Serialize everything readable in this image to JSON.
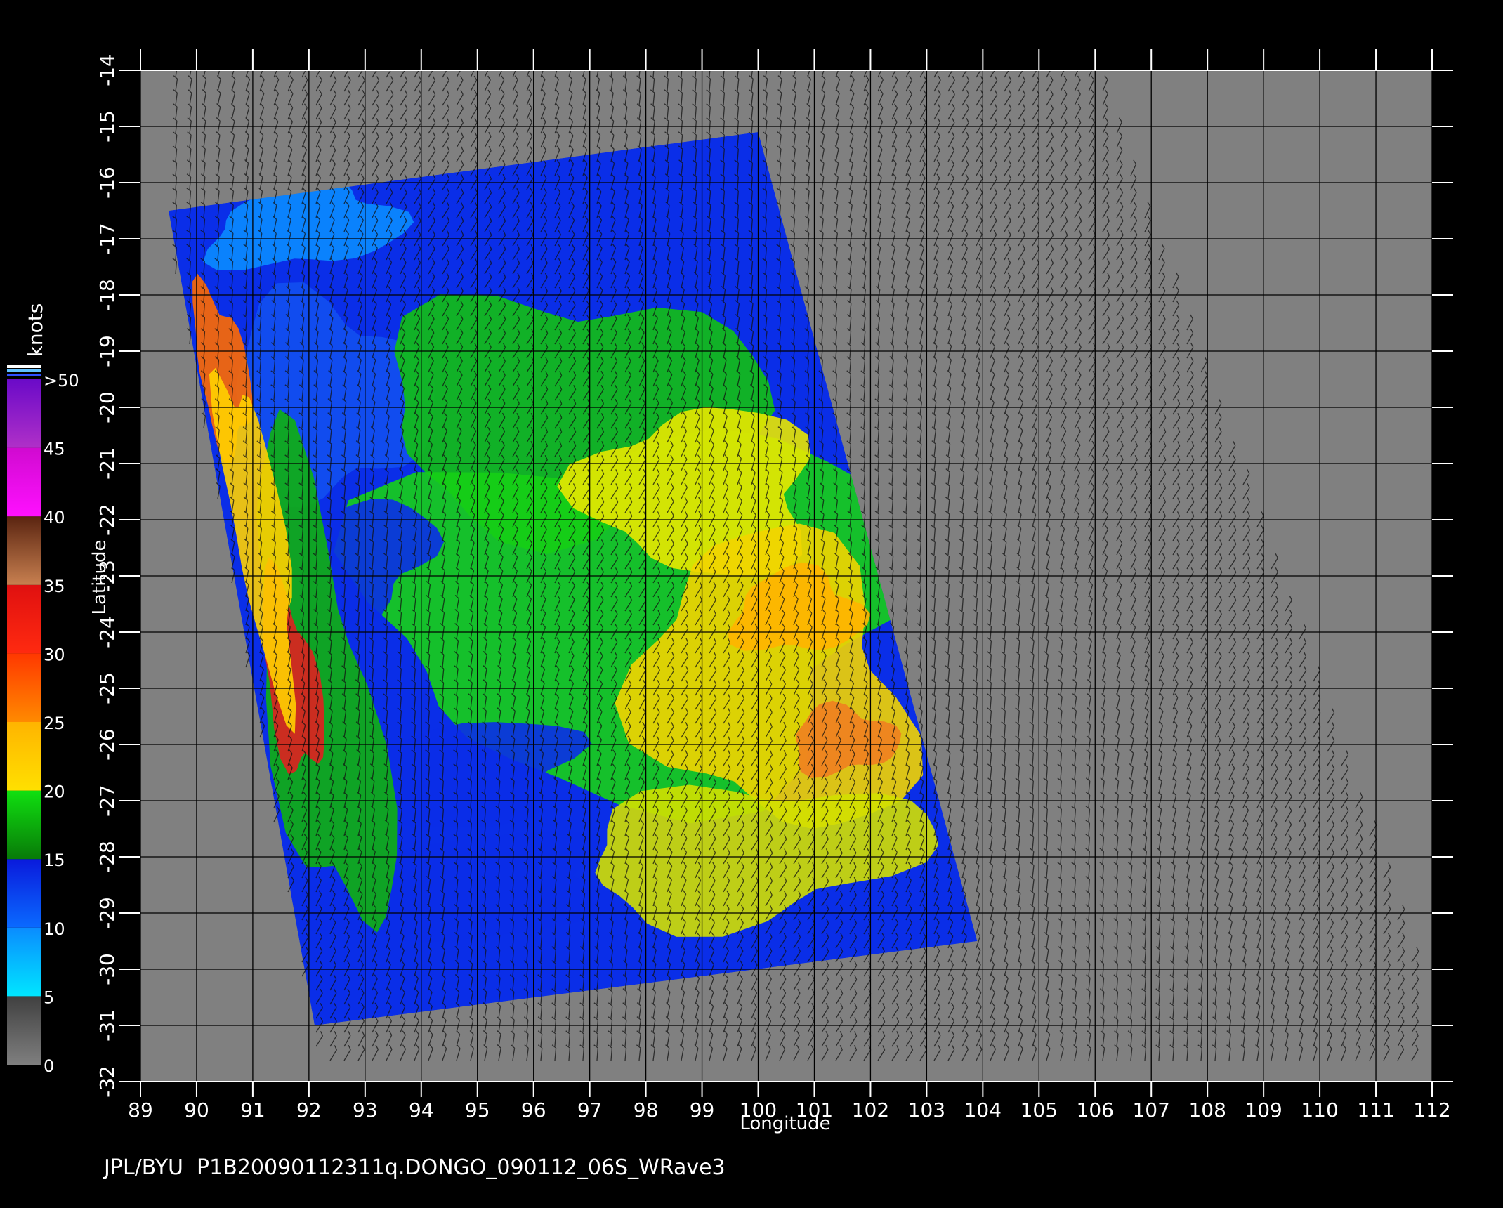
{
  "map": {
    "axis_x_label": "Longitude",
    "axis_y_label": "Latitude",
    "lon_ticks": [
      "89",
      "90",
      "91",
      "92",
      "93",
      "94",
      "95",
      "96",
      "97",
      "98",
      "99",
      "100",
      "101",
      "102",
      "103",
      "104",
      "105",
      "106",
      "107",
      "108",
      "109",
      "110",
      "111",
      "112"
    ],
    "lat_ticks": [
      "-14",
      "-15",
      "-16",
      "-17",
      "-18",
      "-19",
      "-20",
      "-21",
      "-22",
      "-23",
      "-24",
      "-25",
      "-26",
      "-27",
      "-28",
      "-29",
      "-30",
      "-31",
      "-32"
    ],
    "lon_range": [
      89,
      112
    ],
    "lat_range": [
      -32,
      -14
    ],
    "grid": true,
    "swath_corners_lonlat": [
      [
        89.5,
        -16.5
      ],
      [
        100.0,
        -15.1
      ],
      [
        103.9,
        -29.5
      ],
      [
        92.1,
        -31.0
      ]
    ],
    "footer": "JPL/BYU  P1B20090112311q.DONGO_090112_06S_WRave3",
    "background_color": "#808080",
    "grid_color": "#000000"
  },
  "legend": {
    "unit": "knots",
    "labels": [
      ">50",
      "45",
      "40",
      "35",
      "30",
      "25",
      "20",
      "15",
      "10",
      "5",
      "0"
    ],
    "bands": [
      {
        "from": 0,
        "to": 5,
        "colors": [
          "#7f7f7f",
          "#404040"
        ]
      },
      {
        "from": 5,
        "to": 10,
        "colors": [
          "#00e6ff",
          "#0a8cff"
        ]
      },
      {
        "from": 10,
        "to": 15,
        "colors": [
          "#0a6aff",
          "#0a1adc"
        ]
      },
      {
        "from": 15,
        "to": 20,
        "colors": [
          "#087a08",
          "#10e010"
        ]
      },
      {
        "from": 20,
        "to": 25,
        "colors": [
          "#ffe000",
          "#ffb400"
        ]
      },
      {
        "from": 25,
        "to": 30,
        "colors": [
          "#ff8a00",
          "#ff3800"
        ]
      },
      {
        "from": 30,
        "to": 35,
        "colors": [
          "#ff2a10",
          "#e01010"
        ]
      },
      {
        "from": 35,
        "to": 40,
        "colors": [
          "#c88050",
          "#5a2410"
        ]
      },
      {
        "from": 40,
        "to": 45,
        "colors": [
          "#ff10ff",
          "#d00ad0"
        ]
      },
      {
        "from": 45,
        "to": 50,
        "colors": [
          "#b030c8",
          "#6a0ac8"
        ]
      }
    ],
    "top_stripes": [
      "#ffffff",
      "#60c0ff",
      "#3050ff"
    ]
  }
}
